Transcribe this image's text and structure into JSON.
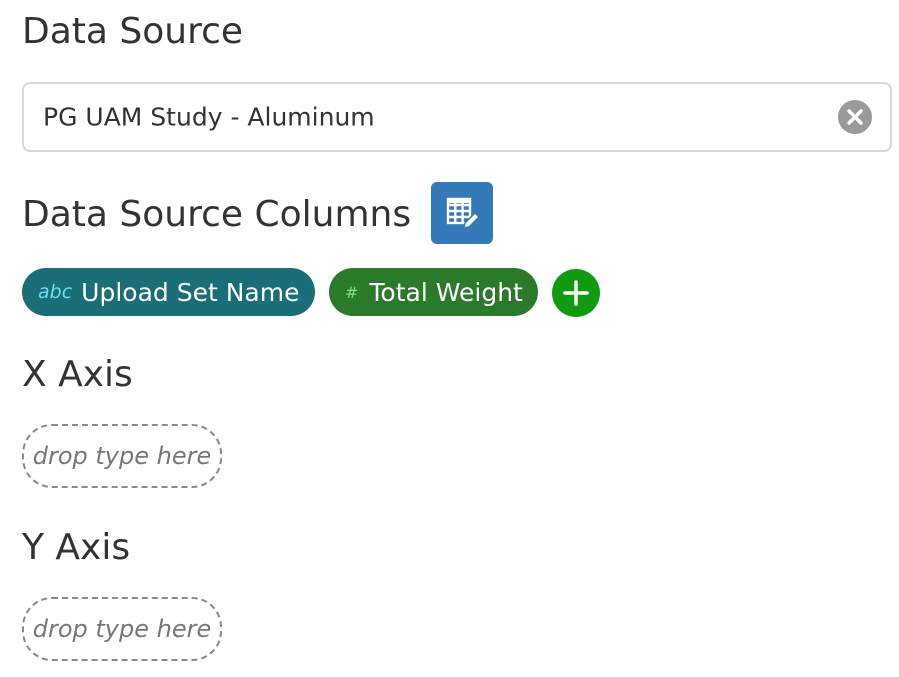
{
  "data_source": {
    "heading": "Data Source",
    "selected_value": "PG UAM Study - Aluminum",
    "clear_icon": "close-circle-icon"
  },
  "columns": {
    "heading": "Data Source Columns",
    "edit_icon": "table-edit-icon",
    "chips": [
      {
        "type_label": "abc",
        "name": "Upload Set Name",
        "kind": "text",
        "color": "#196e78"
      },
      {
        "type_label": "#",
        "name": "Total Weight",
        "kind": "number",
        "color": "#2a7a2a"
      }
    ],
    "add_icon": "plus-icon",
    "add_color": "#0f9a0f"
  },
  "x_axis": {
    "heading": "X Axis",
    "placeholder": "drop type here"
  },
  "y_axis": {
    "heading": "Y Axis",
    "placeholder": "drop type here"
  },
  "colors": {
    "edit_button": "#337ab7",
    "clear_button": "#9a9a9a"
  }
}
